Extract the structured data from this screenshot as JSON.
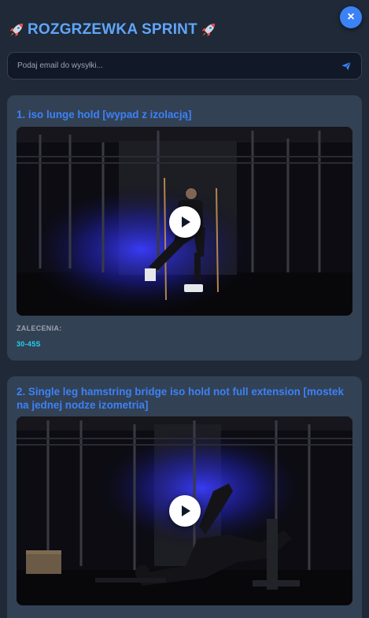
{
  "header": {
    "title": "ROZGRZEWKA SPRINT",
    "close_label": "×"
  },
  "email": {
    "placeholder": "Podaj email do wysyłki..."
  },
  "exercises": [
    {
      "title": "1. iso lunge hold [wypad z izolacją]",
      "recommendations_label": "ZALECENIA:",
      "recommendations_value": "30-45S"
    },
    {
      "title": "2. Single leg hamstring bridge iso hold not full extension [mostek na jednej nodze izometria]"
    }
  ],
  "colors": {
    "background": "#1f2937",
    "card": "#334155",
    "accent": "#3b82f6",
    "title": "#60a5fa",
    "value": "#22d3ee"
  },
  "icons": [
    "rocket-icon",
    "close-icon",
    "send-icon",
    "play-icon"
  ]
}
